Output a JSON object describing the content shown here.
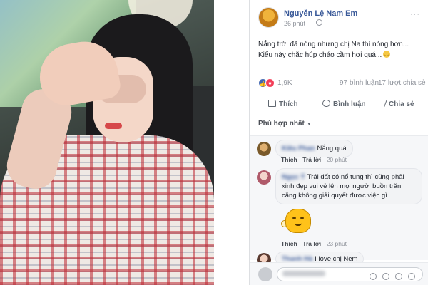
{
  "post": {
    "author": "Nguyễn Lệ Nam Em",
    "time": "26 phút ·",
    "more": "···",
    "text_line1": "Nắng trời đã nóng nhưng chị Na thì nóng hơn...",
    "text_line2": "Kiểu này chắc húp cháo cầm hơi quá...",
    "reaction_count": "1,9K",
    "comment_count": "97 bình luận",
    "share_count": "17 lượt chia sẻ",
    "actions": {
      "like": "Thích",
      "comment": "Bình luận",
      "share": "Chia sẻ"
    },
    "filter": "Phù hợp nhất",
    "filter_caret": "▼",
    "like_glyph": "👍",
    "love_glyph": "♥"
  },
  "comments": [
    {
      "name": "Kiều Phan",
      "text": "Nắng quá",
      "meta_like": "Thích",
      "meta_reply": "Trả lời",
      "meta_time": "20 phút"
    },
    {
      "name": "Ngọc Ý",
      "text": "Trái đất có nổ tung thì cũng phải xinh đẹp vui vẻ lên mọi người buồn trăn căng không giải quyết được việc gì",
      "meta_like": "Thích",
      "meta_reply": "Trả lời",
      "meta_time": "23 phút"
    },
    {
      "name": "Thanh Hà",
      "text": "I love chị Nem"
    }
  ],
  "colors": {
    "link": "#385898",
    "muted": "#90949c",
    "like": "#4267b2",
    "love": "#f33e58"
  }
}
